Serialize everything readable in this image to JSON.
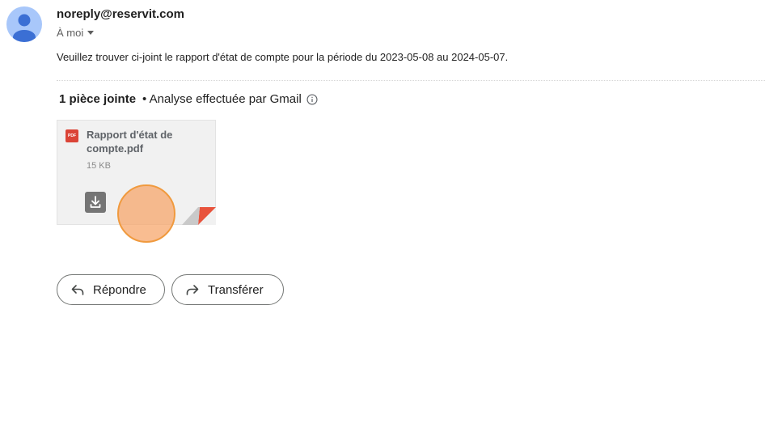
{
  "email": {
    "sender": "noreply@reservit.com",
    "recipient_label": "À moi",
    "body": "Veuillez trouver ci-joint le rapport d'état de compte pour la période du 2023-05-08 au 2024-05-07."
  },
  "attachments": {
    "count_label": "1 pièce jointe",
    "scan_label": "• Analyse effectuée par Gmail",
    "files": [
      {
        "name": "Rapport d'état de compte.pdf",
        "size": "15 KB",
        "type_badge": "PDF"
      }
    ]
  },
  "actions": {
    "reply_label": "Répondre",
    "forward_label": "Transférer"
  },
  "colors": {
    "avatar_bg": "#a8c7fa",
    "avatar_fg": "#3b6fd4",
    "pdf_red": "#db4437"
  },
  "icons": {
    "avatar": "person-icon",
    "recipient_caret": "caret-down-icon",
    "info": "info-icon",
    "file": "pdf-icon",
    "download": "download-icon",
    "reply": "reply-icon",
    "forward": "forward-icon"
  }
}
